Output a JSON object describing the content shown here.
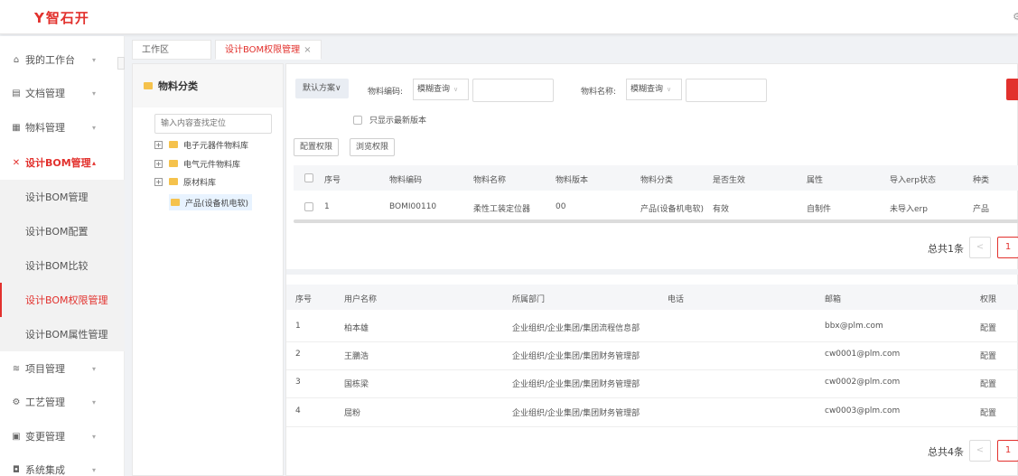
{
  "header": {
    "logo_text": "智石开",
    "logo_mark": "Y",
    "right_icon": "gear-icon"
  },
  "sidebar": {
    "items": [
      {
        "label": "我的工作台",
        "icon": "home-icon"
      },
      {
        "label": "文档管理",
        "icon": "document-icon"
      },
      {
        "label": "物料管理",
        "icon": "material-icon"
      },
      {
        "label": "设计BOM管理",
        "icon": "design-icon"
      },
      {
        "label": "项目管理",
        "icon": "project-icon"
      },
      {
        "label": "工艺管理",
        "icon": "process-icon"
      },
      {
        "label": "变更管理",
        "icon": "change-icon"
      },
      {
        "label": "系统集成",
        "icon": "integration-icon"
      }
    ],
    "subitems": [
      {
        "label": "设计BOM管理"
      },
      {
        "label": "设计BOM配置"
      },
      {
        "label": "设计BOM比较"
      },
      {
        "label": "设计BOM权限管理"
      },
      {
        "label": "设计BOM属性管理"
      }
    ],
    "active_color": "#e2312d"
  },
  "tabs": [
    {
      "label": "工作区"
    },
    {
      "label": "设计BOM权限管理",
      "close": "×"
    }
  ],
  "tree": {
    "title": "物料分类",
    "search_placeholder": "输入内容查找定位",
    "nodes": [
      {
        "label": "电子元器件物料库",
        "expander": "+"
      },
      {
        "label": "电气元件物料库",
        "expander": "+"
      },
      {
        "label": "原材料库",
        "expander": "+"
      },
      {
        "label": "产品(设备机电软)"
      }
    ]
  },
  "filters": {
    "scheme_label": "默认方案∨",
    "code_label": "物料编码:",
    "code_mode": "模糊查询",
    "name_label": "物料名称:",
    "name_mode": "模糊查询",
    "latest_only_label": "只显示最新版本",
    "config_btn": "配置权限",
    "browse_btn": "浏览权限"
  },
  "material_table": {
    "columns": [
      "序号",
      "物料编码",
      "物料名称",
      "物料版本",
      "物料分类",
      "是否生效",
      "属性",
      "导入erp状态",
      "种类"
    ],
    "rows": [
      [
        "1",
        "BOMI00110",
        "柔性工装定位器",
        "00",
        "产品(设备机电软)",
        "有效",
        "自制件",
        "未导入erp",
        "产品"
      ]
    ],
    "total": "总共1条",
    "page": "1",
    "prev": "<"
  },
  "user_table": {
    "columns": [
      "序号",
      "用户名称",
      "所属部门",
      "电话",
      "邮箱",
      "权限"
    ],
    "rows": [
      [
        "1",
        "柏本雄",
        "企业组织/企业集团/集团流程信息部",
        "",
        "bbx@plm.com",
        "配置"
      ],
      [
        "2",
        "王鵬浩",
        "企业组织/企业集团/集团财务管理部",
        "",
        "cw0001@plm.com",
        "配置"
      ],
      [
        "3",
        "国栋梁",
        "企业组织/企业集团/集团财务管理部",
        "",
        "cw0002@plm.com",
        "配置"
      ],
      [
        "4",
        "屈粉",
        "企业组织/企业集团/集团财务管理部",
        "",
        "cw0003@plm.com",
        "配置"
      ]
    ],
    "total": "总共4条",
    "page": "1",
    "prev": "<"
  }
}
